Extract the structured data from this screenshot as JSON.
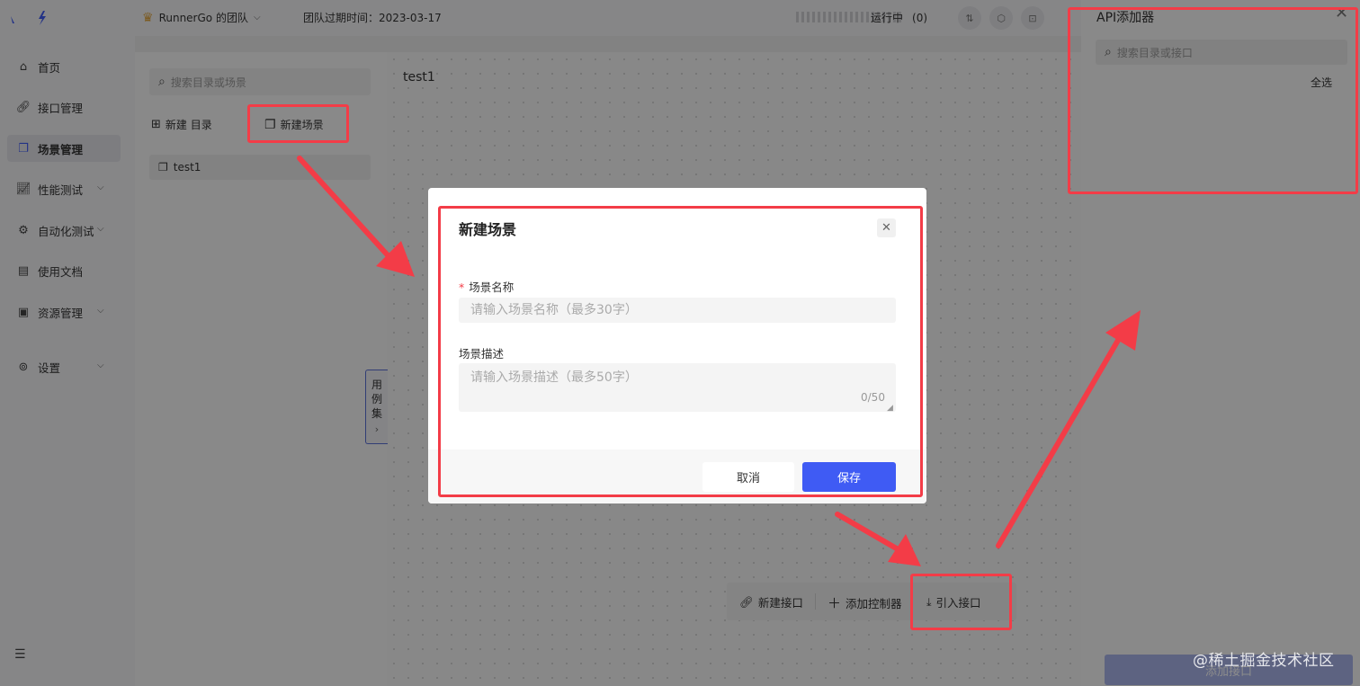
{
  "topbar": {
    "team_name": "RunnerGo 的团队",
    "expire_text": "团队过期时间：2023-03-17",
    "running_label": "运行中",
    "running_count": "(0)"
  },
  "sidebar": {
    "items": [
      {
        "label": "首页",
        "icon": "home-icon"
      },
      {
        "label": "接口管理",
        "icon": "link-icon"
      },
      {
        "label": "场景管理",
        "icon": "scene-icon",
        "active": true
      },
      {
        "label": "性能测试",
        "icon": "chart-icon"
      },
      {
        "label": "自动化测试",
        "icon": "gear-icon"
      },
      {
        "label": "使用文档",
        "icon": "doc-icon"
      },
      {
        "label": "资源管理",
        "icon": "monitor-icon"
      },
      {
        "label": "设置",
        "icon": "settings-icon"
      }
    ]
  },
  "tree": {
    "search_placeholder": "搜索目录或场景",
    "new_folder_label": "新建 目录",
    "new_scene_label": "新建场景",
    "items": [
      {
        "label": "test1"
      }
    ]
  },
  "canvas": {
    "title": "test1",
    "case_tab": [
      "用",
      "例",
      "集"
    ],
    "toolbar": {
      "new_api": "新建接口",
      "add_controller": "添加控制器",
      "import_api": "引入接口"
    }
  },
  "drawer": {
    "title": "API添加器",
    "search_placeholder": "搜索目录或接口",
    "select_all": "全选",
    "add_button": "添加接口"
  },
  "modal": {
    "title": "新建场景",
    "name_label": "场景名称",
    "name_placeholder": "请输入场景名称（最多30字）",
    "desc_label": "场景描述",
    "desc_placeholder": "请输入场景描述（最多50字）",
    "desc_counter": "0/50",
    "cancel": "取消",
    "save": "保存"
  },
  "watermark": "@稀土掘金技术社区",
  "colors": {
    "primary": "#3f5bf4",
    "annotation": "#f33c47",
    "required": "#f33c47"
  }
}
